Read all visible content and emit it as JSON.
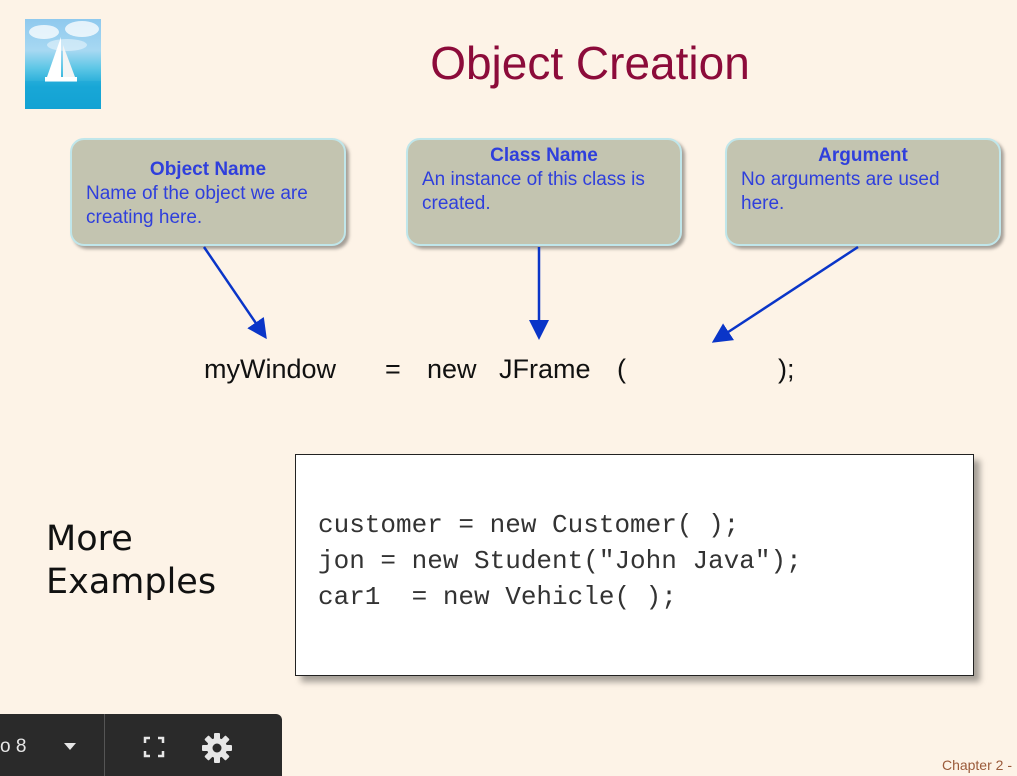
{
  "slide": {
    "title": "Object Creation",
    "callouts": [
      {
        "heading": "Object Name",
        "body": "Name of the object we are creating here."
      },
      {
        "heading": "Class Name",
        "body": "An instance of this class is created."
      },
      {
        "heading": "Argument",
        "body": "No arguments are used here."
      }
    ],
    "statement": {
      "object": "myWindow",
      "equals": "=",
      "new_kw": "new",
      "class_name": "JFrame",
      "open_paren": "(",
      "close": ");"
    },
    "more_label_line1": "More",
    "more_label_line2": "Examples",
    "code_lines": [
      "customer = new Customer( );",
      "jon = new Student(\"John Java\");",
      "car1  = new Vehicle( );"
    ],
    "footer": "Chapter 2 -"
  },
  "toolbar": {
    "page_text": "o 8",
    "icons": [
      "chevron-down-icon",
      "fullscreen-icon",
      "gear-icon"
    ]
  },
  "colors": {
    "background": "#fdf3e7",
    "title": "#8c0b3a",
    "callout_fill": "#c3c4b0",
    "callout_text": "#2f3fdc",
    "arrow": "#0a35c8",
    "toolbar": "#2a2a2a"
  }
}
